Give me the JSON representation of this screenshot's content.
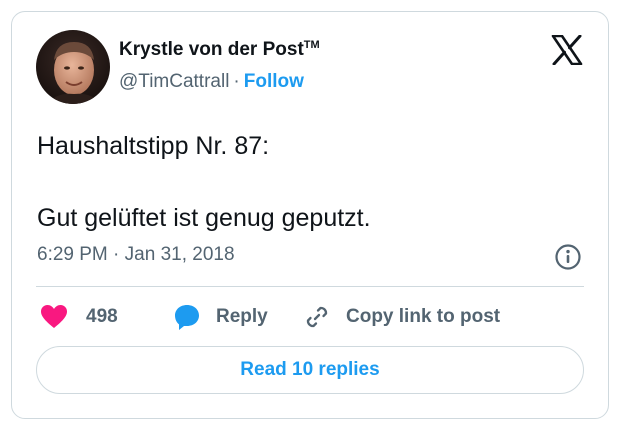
{
  "author": {
    "display_name": "Krystle von der Post",
    "trademark": "TM",
    "handle": "@TimCattrall",
    "separator": "·",
    "follow_label": "Follow"
  },
  "icons": {
    "brand": "x-logo-icon",
    "info": "info-icon",
    "like": "heart-icon",
    "reply": "speech-bubble-icon",
    "copy": "link-icon"
  },
  "tweet": {
    "line1": "Haushaltstipp Nr. 87:",
    "line2": "Gut gelüftet ist genug geputzt.",
    "time": "6:29 PM",
    "date_separator": "·",
    "date": "Jan 31, 2018"
  },
  "actions": {
    "like_count": "498",
    "reply_label": "Reply",
    "copy_label": "Copy link to post"
  },
  "read_replies_label": "Read 10 replies",
  "colors": {
    "accent": "#1d9bf0",
    "like": "#f91880",
    "text": "#0f1419",
    "secondary": "#536471",
    "border": "#cfd9de"
  }
}
